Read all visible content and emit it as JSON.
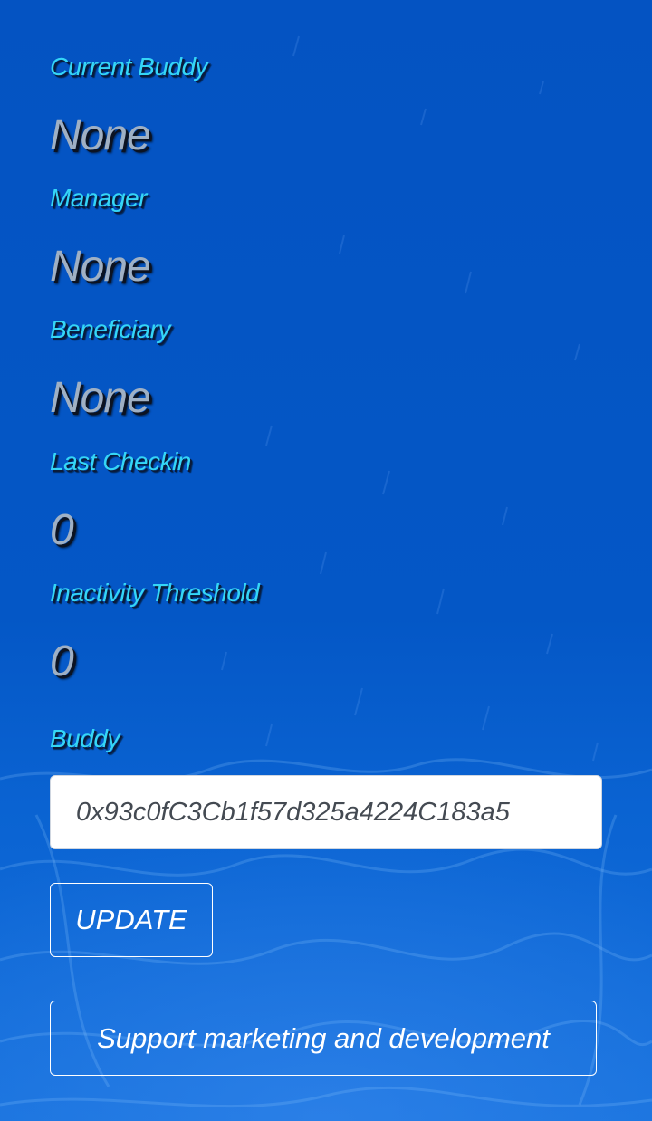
{
  "fields": [
    {
      "label": "Current Buddy",
      "value": "None"
    },
    {
      "label": "Manager",
      "value": "None"
    },
    {
      "label": "Beneficiary",
      "value": "None"
    },
    {
      "label": "Last Checkin",
      "value": "0"
    },
    {
      "label": "Inactivity Threshold",
      "value": "0"
    }
  ],
  "buddy": {
    "label": "Buddy",
    "input_value": "0x93c0fC3Cb1f57d325a4224C183a5"
  },
  "buttons": {
    "update_label": "UPDATE",
    "support_label": "Support marketing and development"
  },
  "colors": {
    "background": "#0457c6",
    "label": "#35d6f6",
    "value": "#9fb0c4",
    "button_border": "#ffffff"
  }
}
